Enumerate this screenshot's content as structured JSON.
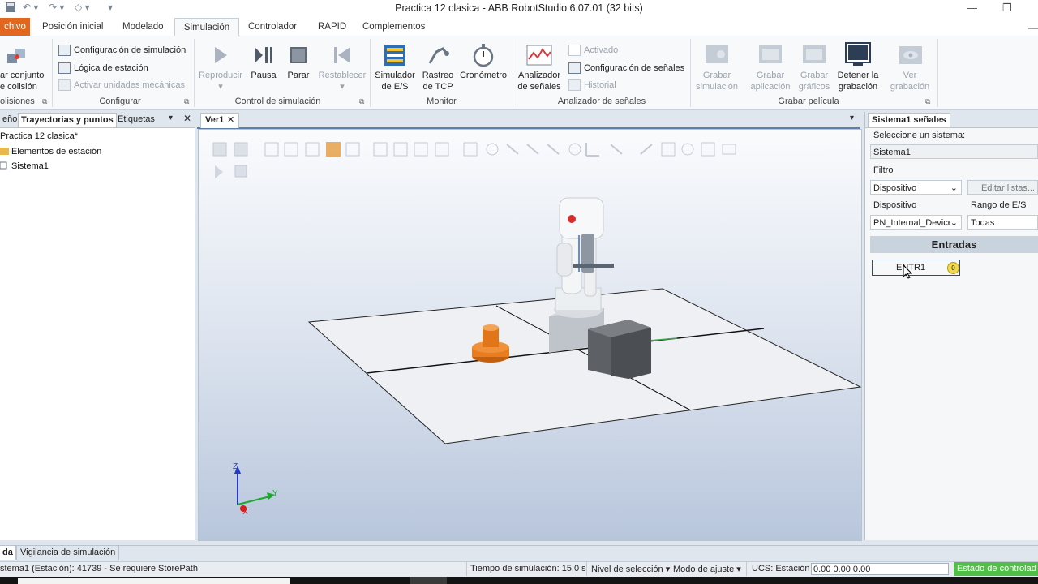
{
  "window": {
    "title": "Practica 12 clasica - ABB RobotStudio 6.07.01 (32 bits)"
  },
  "tabs": [
    {
      "label": "chivo"
    },
    {
      "label": "Posición inicial"
    },
    {
      "label": "Modelado"
    },
    {
      "label": "Simulación"
    },
    {
      "label": "Controlador"
    },
    {
      "label": "RAPID"
    },
    {
      "label": "Complementos"
    }
  ],
  "ribbon": {
    "colisiones": {
      "button": "ar conjunto",
      "button2": "e colisión",
      "group": "olisiones"
    },
    "configurar": {
      "items": [
        {
          "label": "Configuración de simulación",
          "disabled": false
        },
        {
          "label": "Lógica de estación",
          "disabled": false
        },
        {
          "label": "Activar unidades mecánicas",
          "disabled": true
        }
      ],
      "group": "Configurar"
    },
    "control": {
      "buttons": [
        {
          "label": "Reproducir",
          "disabled": true
        },
        {
          "label": "Pausa",
          "disabled": false
        },
        {
          "label": "Parar",
          "disabled": false
        },
        {
          "label": "Restablecer",
          "disabled": true
        }
      ],
      "group": "Control de simulación"
    },
    "monitor": {
      "buttons": [
        {
          "l1": "Simulador",
          "l2": "de E/S"
        },
        {
          "l1": "Rastreo",
          "l2": "de TCP"
        },
        {
          "l1": "Cronómetro",
          "l2": ""
        }
      ],
      "group": "Monitor"
    },
    "analizador": {
      "button_l1": "Analizador",
      "button_l2": "de señales",
      "items": [
        {
          "label": "Activado",
          "disabled": true
        },
        {
          "label": "Configuración de señales",
          "disabled": false
        },
        {
          "label": "Historial",
          "disabled": true
        }
      ],
      "group": "Analizador de señales"
    },
    "grabar": {
      "buttons": [
        {
          "l1": "Grabar",
          "l2": "simulación",
          "disabled": true
        },
        {
          "l1": "Grabar",
          "l2": "aplicación",
          "disabled": true
        },
        {
          "l1": "Grabar",
          "l2": "gráficos",
          "disabled": true
        },
        {
          "l1": "Detener la",
          "l2": "grabación",
          "disabled": false
        },
        {
          "l1": "Ver",
          "l2": "grabación",
          "disabled": true
        }
      ],
      "group": "Grabar película"
    }
  },
  "left_panel": {
    "tabs": [
      "eño",
      "Trayectorias y puntos",
      "Etiquetas"
    ],
    "tree": [
      {
        "label": "Practica 12 clasica*",
        "depth": 0
      },
      {
        "label": "Elementos de estación",
        "depth": 1
      },
      {
        "label": "Sistema1",
        "depth": 1
      }
    ]
  },
  "viewport": {
    "tab": "Ver1",
    "axes": {
      "x": "X",
      "y": "Y",
      "z": "Z"
    }
  },
  "right_panel": {
    "title": "Sistema1 señales",
    "select_system_label": "Seleccione un sistema:",
    "system_value": "Sistema1",
    "filter_label": "Filtro",
    "filter_value": "Dispositivo",
    "edit_lists": "Editar listas...",
    "device_label": "Dispositivo",
    "range_label": "Rango de E/S",
    "device_value": "PN_Internal_Device",
    "range_value": "Todas",
    "section": "Entradas",
    "input_signal": "ENTR1",
    "input_state": "0"
  },
  "bottom_tabs": [
    "da",
    "Vigilancia de simulación"
  ],
  "status_bar": {
    "message": "stema1 (Estación): 41739 - Se requiere StorePath",
    "sim_time": "Tiempo de simulación: 15,0 s",
    "selection_level": "Nivel de selección",
    "snap_mode": "Modo de ajuste",
    "ucs": "UCS: Estación",
    "coords": "0.00  0.00  0.00",
    "controller_state": "Estado de controlad"
  },
  "colors": {
    "file_tab": "#e3661f",
    "robot_part": "#e87c1e",
    "controller_ok": "#4fbf45"
  }
}
